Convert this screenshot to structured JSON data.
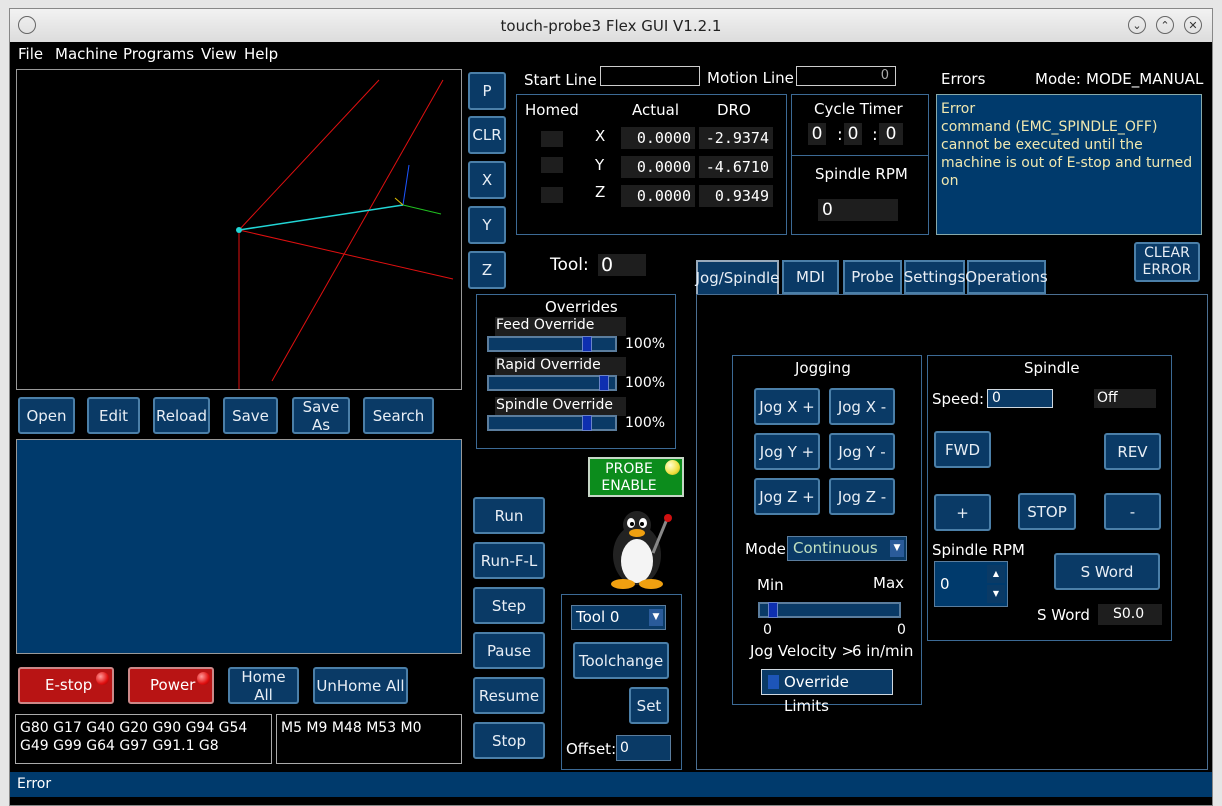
{
  "window": {
    "title": "touch-probe3 Flex GUI V1.2.1"
  },
  "menu": [
    "File",
    "Machine",
    "Programs",
    "View",
    "Help"
  ],
  "toolbar_left": {
    "p": "P",
    "clr": "CLR",
    "x": "X",
    "y": "Y",
    "z": "Z"
  },
  "file_buttons": {
    "open": "Open",
    "edit": "Edit",
    "reload": "Reload",
    "save": "Save",
    "save_as": "Save As",
    "search": "Search"
  },
  "lines": {
    "start_label": "Start Line",
    "start_value": "",
    "motion_label": "Motion Line",
    "motion_value": "0"
  },
  "dro": {
    "homed_label": "Homed",
    "actual_label": "Actual",
    "dro_label": "DRO",
    "axes": [
      {
        "axis": "X",
        "actual": "0.0000",
        "dro": "-2.9374"
      },
      {
        "axis": "Y",
        "actual": "0.0000",
        "dro": "-4.6710"
      },
      {
        "axis": "Z",
        "actual": "0.0000",
        "dro": "0.9349"
      }
    ]
  },
  "cycle_timer": {
    "label": "Cycle Timer",
    "h": "0",
    "m": "0",
    "s": "0",
    "sep1": ":",
    "sep2": ":"
  },
  "spindle_rpm_box": {
    "label": "Spindle RPM",
    "value": "0"
  },
  "errors": {
    "label": "Errors",
    "mode_label": "Mode:",
    "mode_value": "MODE_MANUAL",
    "text": "Error\ncommand (EMC_SPINDLE_OFF) cannot be executed until the machine is out of E-stop and turned on",
    "clear_button": "CLEAR ERROR"
  },
  "tool": {
    "label": "Tool:",
    "value": "0"
  },
  "overrides": {
    "title": "Overrides",
    "items": [
      {
        "label": "Feed Override",
        "value": "100%",
        "level": 0.8
      },
      {
        "label": "Rapid Override",
        "value": "100%",
        "level": 0.95
      },
      {
        "label": "Spindle Override",
        "value": "100%",
        "level": 0.8
      }
    ]
  },
  "tabs": [
    "Jog/Spindle",
    "MDI",
    "Probe",
    "Settings",
    "Operations"
  ],
  "probe": {
    "label": "PROBE ENABLE"
  },
  "run_buttons": {
    "run": "Run",
    "run_fl": "Run-F-L",
    "step": "Step",
    "pause": "Pause",
    "resume": "Resume",
    "stop": "Stop"
  },
  "tool_panel": {
    "select": "Tool 0",
    "toolchange": "Toolchange",
    "set": "Set",
    "offset_label": "Offset:",
    "offset_value": "0"
  },
  "bottom_buttons": {
    "estop": "E-stop",
    "power": "Power",
    "home_all": "Home All",
    "unhome_all": "UnHome All"
  },
  "gcodes": "G80 G17 G40 G20 G90 G94 G54 G49 G99 G64 G97 G91.1 G8",
  "mcodes": "M5 M9 M48 M53 M0",
  "status": "Error",
  "jogging": {
    "title": "Jogging",
    "buttons": [
      "Jog X +",
      "Jog X -",
      "Jog Y +",
      "Jog Y -",
      "Jog Z +",
      "Jog Z -"
    ],
    "mode_label": "Mode",
    "mode_value": "Continuous",
    "min_label": "Min",
    "max_label": "Max",
    "min_value": "0",
    "max_value": "0",
    "velocity_label": "Jog Velocity >",
    "velocity_value": "6 in/min",
    "override_limits": "Override Limits"
  },
  "spindle": {
    "title": "Spindle",
    "speed_label": "Speed:",
    "speed_value": "0",
    "state": "Off",
    "fwd": "FWD",
    "rev": "REV",
    "plus": "+",
    "stop": "STOP",
    "minus": "-",
    "rpm_label": "Spindle RPM",
    "rpm_value": "0",
    "s_word_button": "S Word",
    "s_word_label": "S Word",
    "s_word_value": "S0.0"
  },
  "colors": {
    "accent": "#0a3a66",
    "panel": "#000000",
    "error_bg": "#003a6c",
    "probe_green": "#0c8c1c"
  }
}
